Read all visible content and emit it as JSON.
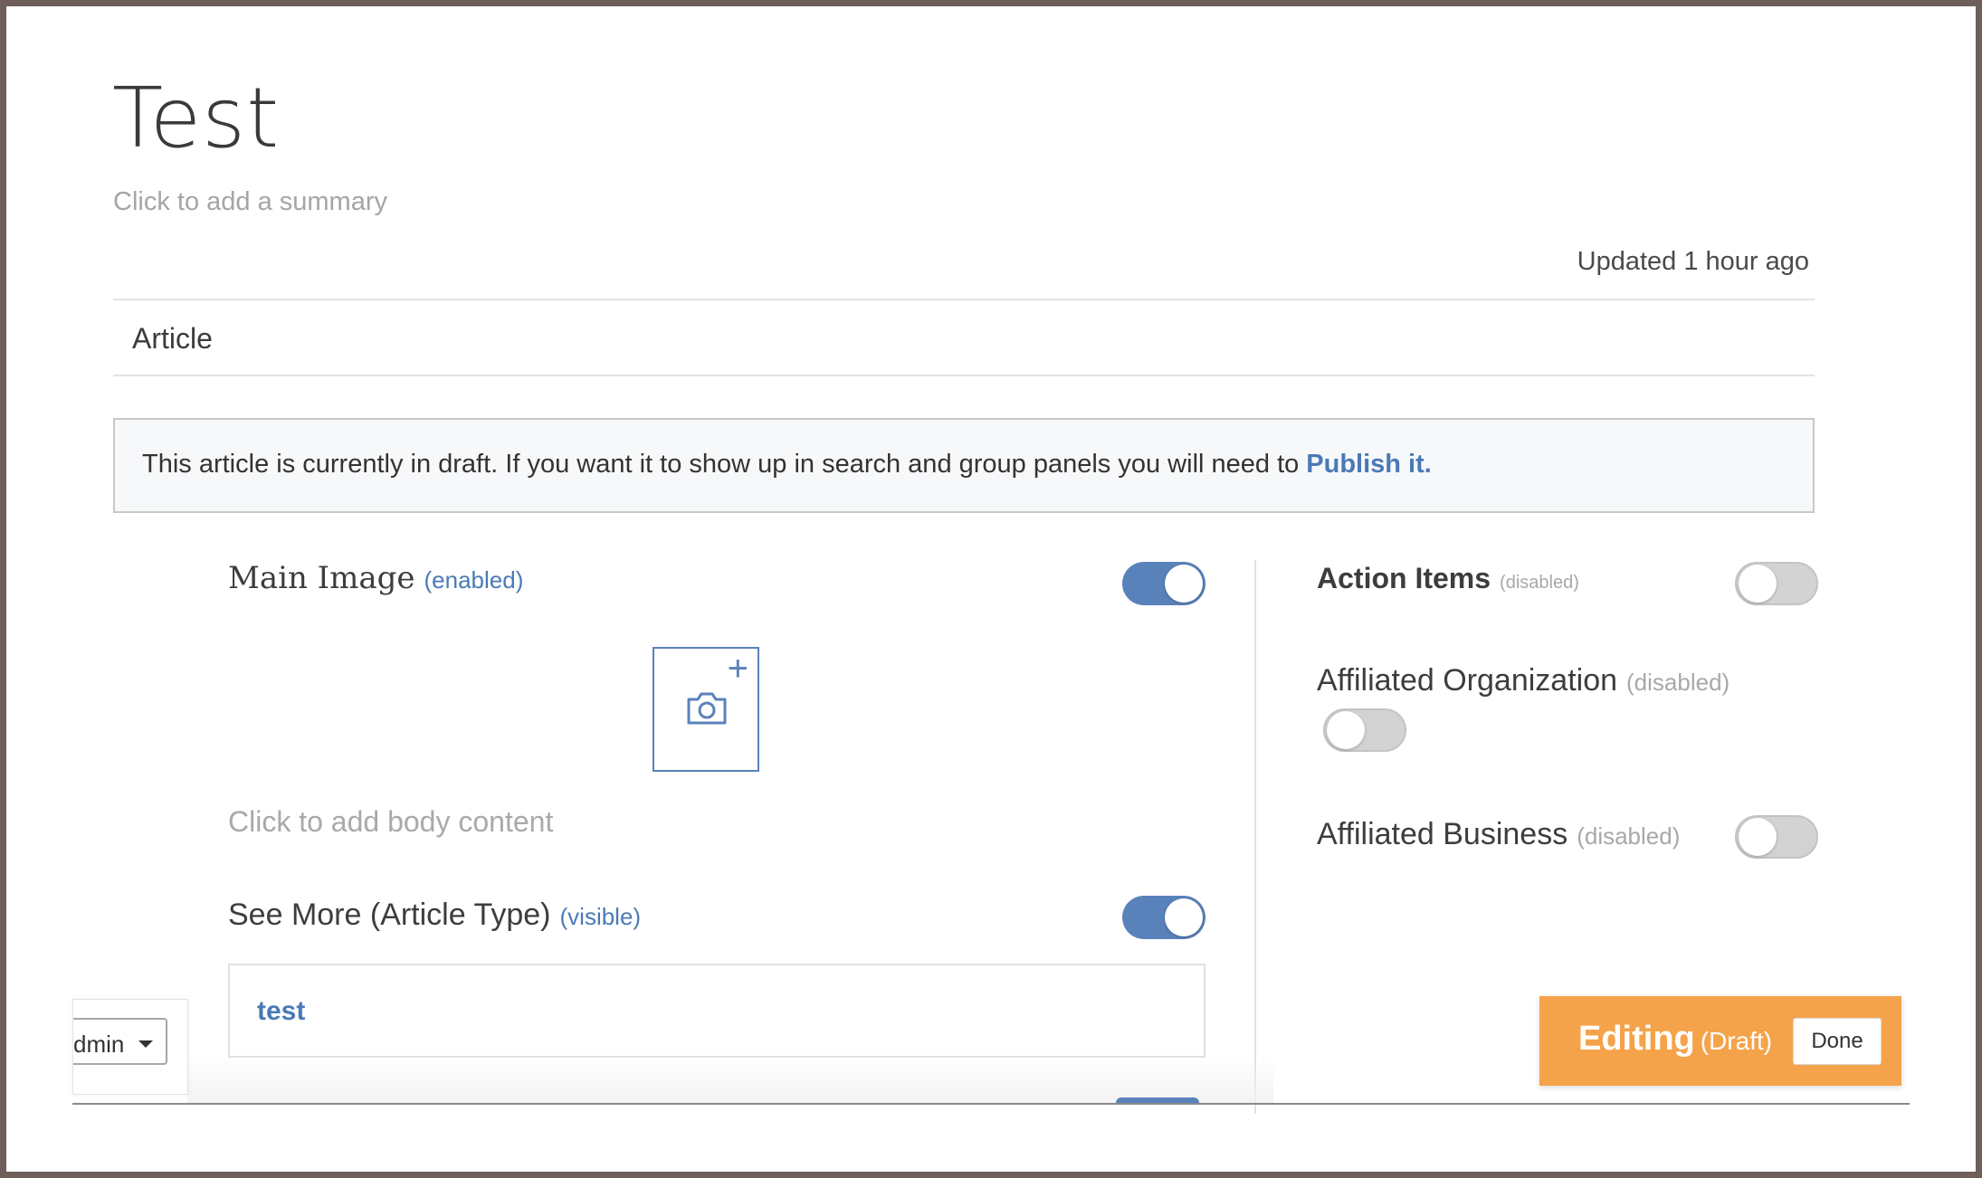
{
  "page": {
    "title": "Test",
    "summary_placeholder": "Click to add a summary",
    "updated": "Updated 1 hour ago",
    "content_type": "Article"
  },
  "notice": {
    "text": "This article is currently in draft. If you want it to show up in search and group panels you will need to",
    "link": "Publish it."
  },
  "left": {
    "main_image": {
      "label": "Main Image",
      "state": "(enabled)",
      "on": true
    },
    "image_icons": [
      "camera-icon",
      "plus-icon"
    ],
    "body_placeholder": "Click to add body content",
    "see_more": {
      "label": "See More (Article Type)",
      "state": "(visible)",
      "on": true,
      "value": "test"
    }
  },
  "right": {
    "action_items": {
      "label": "Action Items",
      "state": "(disabled)",
      "on": false
    },
    "affiliated_org": {
      "label": "Affiliated Organization",
      "state": "(disabled)",
      "on": false
    },
    "affiliated_business": {
      "label": "Affiliated Business",
      "state": "(disabled)",
      "on": false
    }
  },
  "admin": {
    "label": "dmin"
  },
  "editing": {
    "label": "Editing",
    "status": "(Draft)",
    "done": "Done"
  },
  "colors": {
    "accent": "#5a82ba",
    "link": "#4a7ab5",
    "editing_bar": "#f5a34a"
  }
}
